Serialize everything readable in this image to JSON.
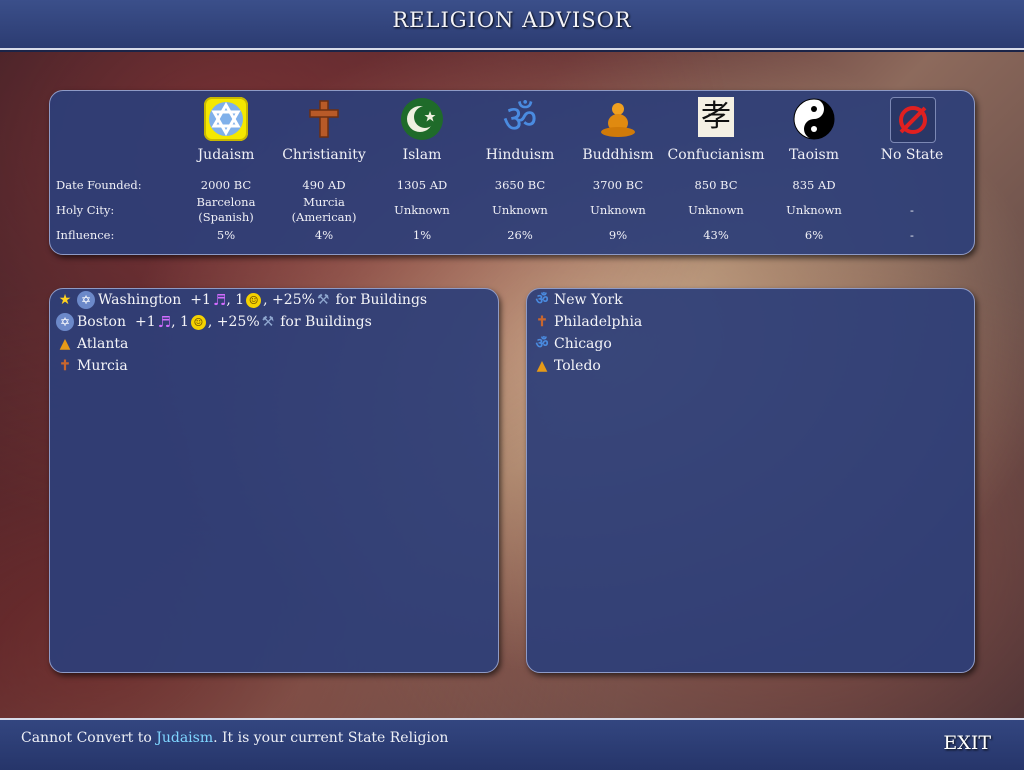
{
  "header": {
    "title": "RELIGION ADVISOR"
  },
  "row_labels": {
    "date_founded": "Date Founded:",
    "holy_city": "Holy City:",
    "influence": "Influence:"
  },
  "religions": [
    {
      "name": "Judaism",
      "icon": "star-of-david-icon",
      "date": "2000 BC",
      "holy_city": "Barcelona",
      "holy_city_owner": "(Spanish)",
      "influence": "5%",
      "selected": true
    },
    {
      "name": "Christianity",
      "icon": "cross-icon",
      "date": "490 AD",
      "holy_city": "Murcia",
      "holy_city_owner": "(American)",
      "influence": "4%"
    },
    {
      "name": "Islam",
      "icon": "crescent-icon",
      "date": "1305 AD",
      "holy_city": "Unknown",
      "holy_city_owner": "",
      "influence": "1%"
    },
    {
      "name": "Hinduism",
      "icon": "om-icon",
      "date": "3650 BC",
      "holy_city": "Unknown",
      "holy_city_owner": "",
      "influence": "26%"
    },
    {
      "name": "Buddhism",
      "icon": "buddha-icon",
      "date": "3700 BC",
      "holy_city": "Unknown",
      "holy_city_owner": "",
      "influence": "9%"
    },
    {
      "name": "Confucianism",
      "icon": "confucian-glyph-icon",
      "date": "850 BC",
      "holy_city": "Unknown",
      "holy_city_owner": "",
      "influence": "43%"
    },
    {
      "name": "Taoism",
      "icon": "yin-yang-icon",
      "date": "835 AD",
      "holy_city": "Unknown",
      "holy_city_owner": "",
      "influence": "6%"
    },
    {
      "name": "No State",
      "icon": "no-state-icon",
      "date": "",
      "holy_city": "-",
      "holy_city_owner": "",
      "influence": "-"
    }
  ],
  "left_cities": [
    {
      "name": "Washington",
      "bonus_culture": "+1",
      "bonus_happy": ", 1",
      "bonus_prod": ", +25%",
      "bonus_tail": "for Buildings"
    },
    {
      "name": "Boston",
      "bonus_culture": "+1",
      "bonus_happy": ", 1",
      "bonus_prod": ", +25%",
      "bonus_tail": "for Buildings"
    },
    {
      "name": "Atlanta"
    },
    {
      "name": "Murcia"
    }
  ],
  "right_cities": [
    {
      "name": "New York"
    },
    {
      "name": "Philadelphia"
    },
    {
      "name": "Chicago"
    },
    {
      "name": "Toledo"
    }
  ],
  "footer": {
    "status_prefix": "Cannot Convert to",
    "status_religion": "Judaism",
    "status_suffix": ". It is your current State Religion",
    "exit_label": "EXIT"
  },
  "colors": {
    "panel": "#2d3e78",
    "selected_icon_bg": "#f4e800",
    "status_highlight": "#7fd6ff"
  }
}
